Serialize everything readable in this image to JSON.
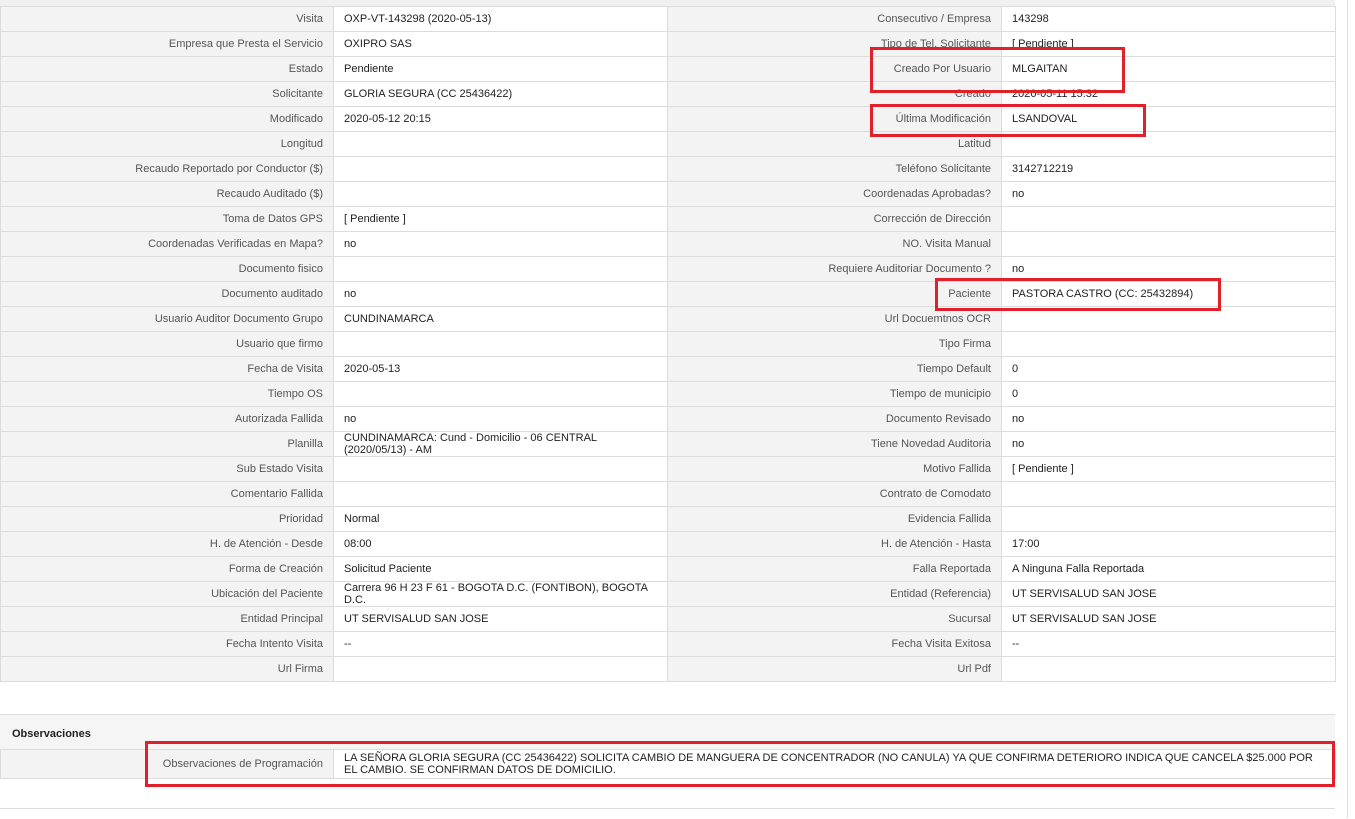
{
  "rows": [
    {
      "l1": "Visita",
      "v1": "OXP-VT-143298 (2020-05-13)",
      "l2": "Consecutivo / Empresa",
      "v2": "143298"
    },
    {
      "l1": "Empresa que Presta el Servicio",
      "v1": "OXIPRO SAS",
      "l2": "Tipo de Tel. Solicitante",
      "v2": "[ Pendiente ]"
    },
    {
      "l1": "Estado",
      "v1": "Pendiente",
      "l2": "Creado Por Usuario",
      "v2": "MLGAITAN"
    },
    {
      "l1": "Solicitante",
      "v1": "GLORIA SEGURA (CC 25436422)",
      "l2": "Creado",
      "v2": "2020-05-11 15:32"
    },
    {
      "l1": "Modificado",
      "v1": "2020-05-12 20:15",
      "l2": "Última Modificación",
      "v2": " LSANDOVAL"
    },
    {
      "l1": "Longitud",
      "v1": "",
      "l2": "Latitud",
      "v2": ""
    },
    {
      "l1": "Recaudo Reportado por Conductor ($)",
      "v1": "",
      "l2": "Teléfono Solicitante",
      "v2": "3142712219"
    },
    {
      "l1": "Recaudo Auditado ($)",
      "v1": "",
      "l2": "Coordenadas Aprobadas?",
      "v2": " no"
    },
    {
      "l1": "Toma de Datos GPS",
      "v1": "[ Pendiente ]",
      "l2": "Corrección de Dirección",
      "v2": ""
    },
    {
      "l1": "Coordenadas Verificadas en Mapa?",
      "v1": " no",
      "l2": "NO. Visita Manual",
      "v2": ""
    },
    {
      "l1": "Documento fisico",
      "v1": "",
      "l2": "Requiere Auditoriar Documento ?",
      "v2": " no"
    },
    {
      "l1": "Documento auditado",
      "v1": " no",
      "l2": "Paciente",
      "v2": "PASTORA CASTRO (CC: 25432894)"
    },
    {
      "l1": "Usuario Auditor Documento Grupo",
      "v1": "CUNDINAMARCA",
      "l2": "Url Docuemtnos OCR",
      "v2": ""
    },
    {
      "l1": "Usuario que firmo",
      "v1": "",
      "l2": "Tipo Firma",
      "v2": ""
    },
    {
      "l1": "Fecha de Visita",
      "v1": " 2020-05-13",
      "l2": "Tiempo Default",
      "v2": "0"
    },
    {
      "l1": "Tiempo OS",
      "v1": "",
      "l2": "Tiempo de municipio",
      "v2": "0"
    },
    {
      "l1": "Autorizada Fallida",
      "v1": " no",
      "l2": "Documento Revisado",
      "v2": " no"
    },
    {
      "l1": "Planilla",
      "v1": "CUNDINAMARCA: Cund - Domicilio - 06 CENTRAL (2020/05/13) - AM",
      "l2": "Tiene Novedad Auditoria",
      "v2": " no"
    },
    {
      "l1": "Sub Estado Visita",
      "v1": "",
      "l2": "Motivo Fallida",
      "v2": "[ Pendiente ]"
    },
    {
      "l1": "Comentario Fallida",
      "v1": "",
      "l2": "Contrato de Comodato",
      "v2": ""
    },
    {
      "l1": "Prioridad",
      "v1": "Normal",
      "l2": "Evidencia Fallida",
      "v2": ""
    },
    {
      "l1": "H. de Atención - Desde",
      "v1": "08:00",
      "l2": "H. de Atención - Hasta",
      "v2": "17:00"
    },
    {
      "l1": "Forma de Creación",
      "v1": "Solicitud Paciente",
      "l2": "Falla Reportada",
      "v2": "A Ninguna Falla Reportada"
    },
    {
      "l1": "Ubicación del Paciente",
      "v1": "Carrera 96 H 23 F 61 - BOGOTA D.C. (FONTIBON), BOGOTA D.C.",
      "l2": "Entidad (Referencia)",
      "v2": "UT SERVISALUD SAN JOSE"
    },
    {
      "l1": "Entidad Principal",
      "v1": "UT SERVISALUD SAN JOSE",
      "l2": "Sucursal",
      "v2": "UT SERVISALUD SAN JOSE"
    },
    {
      "l1": "Fecha Intento Visita",
      "v1": " --",
      "l2": "Fecha Visita Exitosa",
      "v2": " --"
    },
    {
      "l1": "Url Firma",
      "v1": "",
      "l2": "Url Pdf",
      "v2": ""
    }
  ],
  "observaciones": {
    "title": "Observaciones",
    "label": "Observaciones de Programación",
    "value": "  LA SEÑORA GLORIA SEGURA (CC 25436422) SOLICITA CAMBIO DE MANGUERA DE CONCENTRADOR (NO CANULA) YA QUE CONFIRMA DETERIORO INDICA QUE CANCELA $25.000 POR EL CAMBIO. SE CONFIRMAN DATOS DE DOMICILIO."
  },
  "colors": {
    "highlight": "#e0202a",
    "label_bg": "#f3f3f3",
    "border": "#dcdcdc"
  }
}
